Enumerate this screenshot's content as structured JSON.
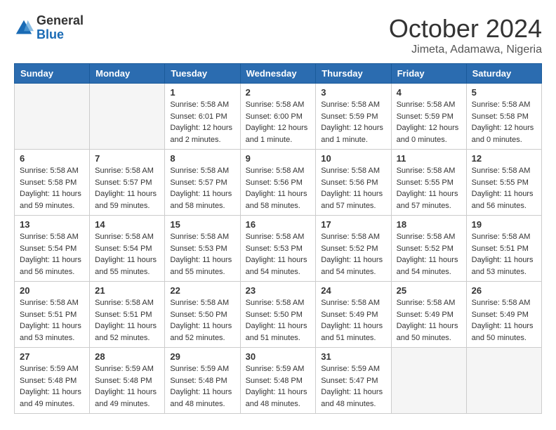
{
  "logo": {
    "text_general": "General",
    "text_blue": "Blue"
  },
  "title": "October 2024",
  "subtitle": "Jimeta, Adamawa, Nigeria",
  "days_of_week": [
    "Sunday",
    "Monday",
    "Tuesday",
    "Wednesday",
    "Thursday",
    "Friday",
    "Saturday"
  ],
  "weeks": [
    [
      {
        "day": "",
        "info": ""
      },
      {
        "day": "",
        "info": ""
      },
      {
        "day": "1",
        "sunrise": "5:58 AM",
        "sunset": "6:01 PM",
        "daylight": "12 hours and 2 minutes."
      },
      {
        "day": "2",
        "sunrise": "5:58 AM",
        "sunset": "6:00 PM",
        "daylight": "12 hours and 1 minute."
      },
      {
        "day": "3",
        "sunrise": "5:58 AM",
        "sunset": "5:59 PM",
        "daylight": "12 hours and 1 minute."
      },
      {
        "day": "4",
        "sunrise": "5:58 AM",
        "sunset": "5:59 PM",
        "daylight": "12 hours and 0 minutes."
      },
      {
        "day": "5",
        "sunrise": "5:58 AM",
        "sunset": "5:58 PM",
        "daylight": "12 hours and 0 minutes."
      }
    ],
    [
      {
        "day": "6",
        "sunrise": "5:58 AM",
        "sunset": "5:58 PM",
        "daylight": "11 hours and 59 minutes."
      },
      {
        "day": "7",
        "sunrise": "5:58 AM",
        "sunset": "5:57 PM",
        "daylight": "11 hours and 59 minutes."
      },
      {
        "day": "8",
        "sunrise": "5:58 AM",
        "sunset": "5:57 PM",
        "daylight": "11 hours and 58 minutes."
      },
      {
        "day": "9",
        "sunrise": "5:58 AM",
        "sunset": "5:56 PM",
        "daylight": "11 hours and 58 minutes."
      },
      {
        "day": "10",
        "sunrise": "5:58 AM",
        "sunset": "5:56 PM",
        "daylight": "11 hours and 57 minutes."
      },
      {
        "day": "11",
        "sunrise": "5:58 AM",
        "sunset": "5:55 PM",
        "daylight": "11 hours and 57 minutes."
      },
      {
        "day": "12",
        "sunrise": "5:58 AM",
        "sunset": "5:55 PM",
        "daylight": "11 hours and 56 minutes."
      }
    ],
    [
      {
        "day": "13",
        "sunrise": "5:58 AM",
        "sunset": "5:54 PM",
        "daylight": "11 hours and 56 minutes."
      },
      {
        "day": "14",
        "sunrise": "5:58 AM",
        "sunset": "5:54 PM",
        "daylight": "11 hours and 55 minutes."
      },
      {
        "day": "15",
        "sunrise": "5:58 AM",
        "sunset": "5:53 PM",
        "daylight": "11 hours and 55 minutes."
      },
      {
        "day": "16",
        "sunrise": "5:58 AM",
        "sunset": "5:53 PM",
        "daylight": "11 hours and 54 minutes."
      },
      {
        "day": "17",
        "sunrise": "5:58 AM",
        "sunset": "5:52 PM",
        "daylight": "11 hours and 54 minutes."
      },
      {
        "day": "18",
        "sunrise": "5:58 AM",
        "sunset": "5:52 PM",
        "daylight": "11 hours and 54 minutes."
      },
      {
        "day": "19",
        "sunrise": "5:58 AM",
        "sunset": "5:51 PM",
        "daylight": "11 hours and 53 minutes."
      }
    ],
    [
      {
        "day": "20",
        "sunrise": "5:58 AM",
        "sunset": "5:51 PM",
        "daylight": "11 hours and 53 minutes."
      },
      {
        "day": "21",
        "sunrise": "5:58 AM",
        "sunset": "5:51 PM",
        "daylight": "11 hours and 52 minutes."
      },
      {
        "day": "22",
        "sunrise": "5:58 AM",
        "sunset": "5:50 PM",
        "daylight": "11 hours and 52 minutes."
      },
      {
        "day": "23",
        "sunrise": "5:58 AM",
        "sunset": "5:50 PM",
        "daylight": "11 hours and 51 minutes."
      },
      {
        "day": "24",
        "sunrise": "5:58 AM",
        "sunset": "5:49 PM",
        "daylight": "11 hours and 51 minutes."
      },
      {
        "day": "25",
        "sunrise": "5:58 AM",
        "sunset": "5:49 PM",
        "daylight": "11 hours and 50 minutes."
      },
      {
        "day": "26",
        "sunrise": "5:58 AM",
        "sunset": "5:49 PM",
        "daylight": "11 hours and 50 minutes."
      }
    ],
    [
      {
        "day": "27",
        "sunrise": "5:59 AM",
        "sunset": "5:48 PM",
        "daylight": "11 hours and 49 minutes."
      },
      {
        "day": "28",
        "sunrise": "5:59 AM",
        "sunset": "5:48 PM",
        "daylight": "11 hours and 49 minutes."
      },
      {
        "day": "29",
        "sunrise": "5:59 AM",
        "sunset": "5:48 PM",
        "daylight": "11 hours and 48 minutes."
      },
      {
        "day": "30",
        "sunrise": "5:59 AM",
        "sunset": "5:48 PM",
        "daylight": "11 hours and 48 minutes."
      },
      {
        "day": "31",
        "sunrise": "5:59 AM",
        "sunset": "5:47 PM",
        "daylight": "11 hours and 48 minutes."
      },
      {
        "day": "",
        "info": ""
      },
      {
        "day": "",
        "info": ""
      }
    ]
  ],
  "labels": {
    "sunrise": "Sunrise:",
    "sunset": "Sunset:",
    "daylight": "Daylight:"
  }
}
